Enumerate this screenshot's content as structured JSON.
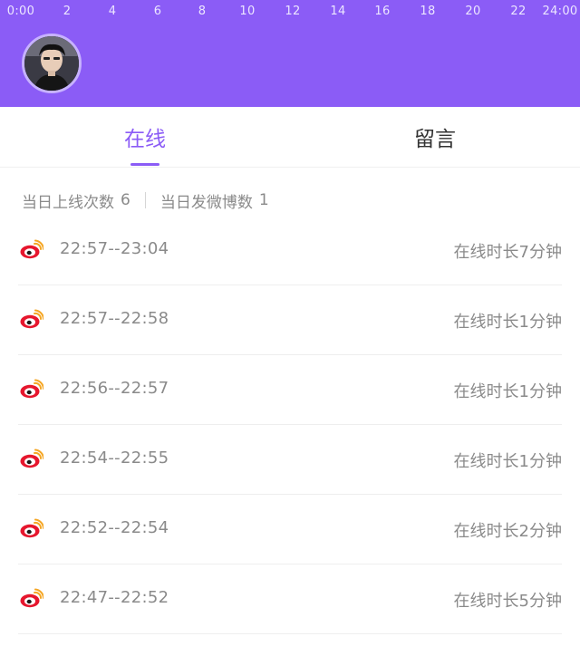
{
  "timeline": {
    "ticks": [
      "0:00",
      "2",
      "4",
      "6",
      "8",
      "10",
      "12",
      "14",
      "16",
      "18",
      "20",
      "22",
      "24:00"
    ]
  },
  "tabs": [
    {
      "label": "在线",
      "active": true
    },
    {
      "label": "留言",
      "active": false
    }
  ],
  "summary": {
    "logins_label": "当日上线次数",
    "logins_value": "6",
    "posts_label": "当日发微博数",
    "posts_value": "1"
  },
  "sessions": [
    {
      "time": "22:57--23:04",
      "duration": "在线时长7分钟"
    },
    {
      "time": "22:57--22:58",
      "duration": "在线时长1分钟"
    },
    {
      "time": "22:56--22:57",
      "duration": "在线时长1分钟"
    },
    {
      "time": "22:54--22:55",
      "duration": "在线时长1分钟"
    },
    {
      "time": "22:52--22:54",
      "duration": "在线时长2分钟"
    },
    {
      "time": "22:47--22:52",
      "duration": "在线时长5分钟"
    }
  ],
  "colors": {
    "accent": "#8b5cf6",
    "text_muted": "#8a8a8a",
    "weibo_red": "#e6162d",
    "weibo_orange": "#f5a623"
  },
  "icons": {
    "session_icon": "weibo-icon"
  }
}
